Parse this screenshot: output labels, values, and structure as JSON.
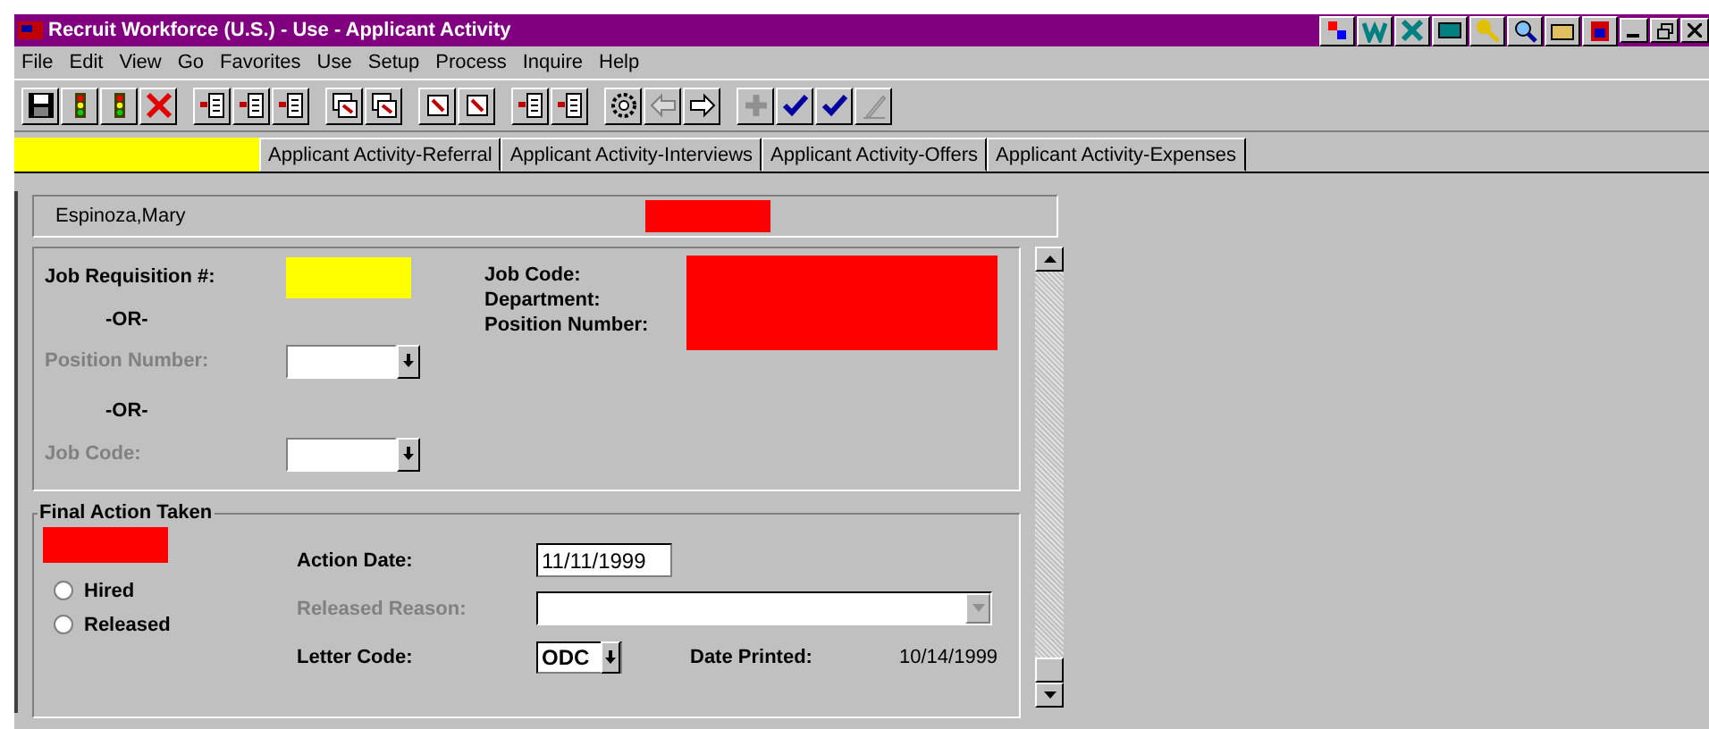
{
  "window": {
    "title": "Recruit Workforce (U.S.) - Use - Applicant Activity"
  },
  "menu": [
    "File",
    "Edit",
    "View",
    "Go",
    "Favorites",
    "Use",
    "Setup",
    "Process",
    "Inquire",
    "Help"
  ],
  "tabs": [
    {
      "label": "Applicant Activity-Referral",
      "selected": false
    },
    {
      "label": "Applicant Activity-Interviews",
      "selected": false
    },
    {
      "label": "Applicant Activity-Offers",
      "selected": false
    },
    {
      "label": "Applicant Activity-Expenses",
      "selected": false
    }
  ],
  "applicant": {
    "name": "Espinoza,Mary"
  },
  "requisition": {
    "label": "Job Requisition #:",
    "or_1": "-OR-",
    "position_label": "Position Number:",
    "position_disabled": true,
    "or_2": "-OR-",
    "job_code_label": "Job Code:",
    "job_code_disabled": true,
    "info_labels": [
      "Job Code:",
      "Department:",
      "Position Number:"
    ]
  },
  "final_action": {
    "title": "Final Action Taken",
    "options": [
      {
        "label": "Hired",
        "checked": false
      },
      {
        "label": "Released",
        "checked": false
      }
    ],
    "action_date_label": "Action Date:",
    "action_date": "11/11/1999",
    "released_reason_label": "Released Reason:",
    "released_reason_disabled": true,
    "letter_code_label": "Letter Code:",
    "letter_code": "ODC",
    "date_printed_label": "Date Printed:",
    "date_printed": "10/14/1999"
  }
}
